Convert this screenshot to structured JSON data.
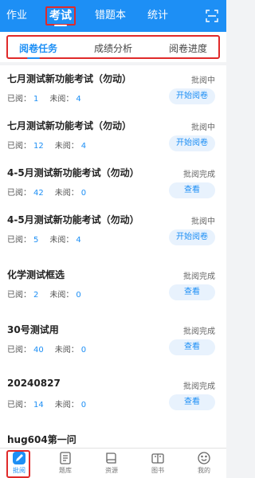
{
  "top_nav": {
    "tabs": [
      "作业",
      "考试",
      "错题本",
      "统计"
    ],
    "active_index": 1,
    "scan_icon": "scan-icon"
  },
  "sub_tabs": {
    "tabs": [
      "阅卷任务",
      "成绩分析",
      "阅卷进度"
    ],
    "active_index": 0
  },
  "stats_labels": {
    "read": "已阅：",
    "unread": "未阅："
  },
  "exams": [
    {
      "title": "七月测试新功能考试（勿动）",
      "status": "批阅中",
      "read": "1",
      "unread": "4",
      "action": "开始阅卷"
    },
    {
      "title": "七月测试新功能考试（勿动）",
      "status": "批阅中",
      "read": "12",
      "unread": "4",
      "action": "开始阅卷"
    },
    {
      "title": "4-5月测试新功能考试（勿动）",
      "status": "批阅完成",
      "read": "42",
      "unread": "0",
      "action": "查看"
    },
    {
      "title": "4-5月测试新功能考试（勿动）",
      "status": "批阅中",
      "read": "5",
      "unread": "4",
      "action": "开始阅卷"
    },
    {
      "title": "化学测试框选",
      "status": "批阅完成",
      "read": "2",
      "unread": "0",
      "action": "查看"
    },
    {
      "title": "30号测试用",
      "status": "批阅完成",
      "read": "40",
      "unread": "0",
      "action": "查看"
    },
    {
      "title": "20240827",
      "status": "批阅完成",
      "read": "14",
      "unread": "0",
      "action": "查看"
    },
    {
      "title": "hug604第一问",
      "status": "",
      "read": "",
      "unread": "",
      "action": ""
    }
  ],
  "bottom_nav": {
    "items": [
      {
        "label": "批阅",
        "icon": "pen-icon"
      },
      {
        "label": "题库",
        "icon": "question-bank-icon"
      },
      {
        "label": "资源",
        "icon": "book-icon"
      },
      {
        "label": "图书",
        "icon": "library-icon"
      },
      {
        "label": "我的",
        "icon": "smile-icon"
      }
    ],
    "active_index": 0
  },
  "colors": {
    "primary": "#1d8ff5",
    "highlight_box": "#e02a2a",
    "button_bg": "#e8f2fd"
  }
}
